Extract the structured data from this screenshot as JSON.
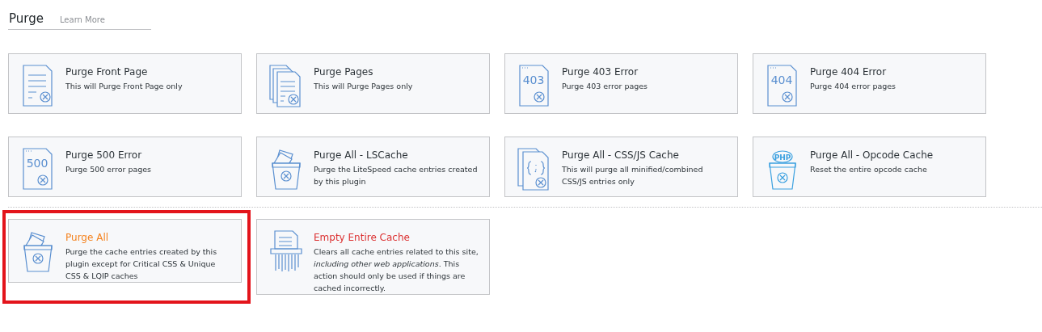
{
  "header": {
    "title": "Purge",
    "link": "Learn More"
  },
  "groups": [
    {
      "cards": [
        {
          "kind": "page",
          "title": "Purge Front Page",
          "description": "This will Purge Front Page only",
          "color": "#2c3338",
          "highlighted": false
        },
        {
          "kind": "pages",
          "title": "Purge Pages",
          "description": "This will Purge Pages only",
          "color": "#2c3338",
          "highlighted": false
        },
        {
          "kind": "error",
          "code": "403",
          "title": "Purge 403 Error",
          "description": "Purge 403 error pages",
          "color": "#2c3338",
          "highlighted": false
        },
        {
          "kind": "error",
          "code": "404",
          "title": "Purge 404 Error",
          "description": "Purge 404 error pages",
          "color": "#2c3338",
          "highlighted": false
        },
        {
          "kind": "error",
          "code": "500",
          "title": "Purge 500 Error",
          "description": "Purge 500 error pages",
          "color": "#2c3338",
          "highlighted": false
        },
        {
          "kind": "bin",
          "title": "Purge All - LSCache",
          "description": "Purge the LiteSpeed cache entries created by this plugin",
          "color": "#2c3338",
          "highlighted": false
        },
        {
          "kind": "code",
          "title": "Purge All - CSS/JS Cache",
          "description": "This will purge all minified/combined CSS/JS entries only",
          "color": "#2c3338",
          "highlighted": false
        },
        {
          "kind": "php",
          "code": "PHP",
          "title": "Purge All - Opcode Cache",
          "description": "Reset the entire opcode cache",
          "color": "#2c3338",
          "highlighted": false
        }
      ]
    },
    {
      "cards": [
        {
          "kind": "bin",
          "title": "Purge All",
          "description": "Purge the cache entries created by this plugin except for Critical CSS & Unique CSS & LQIP caches",
          "color": "#f5831f",
          "highlighted": true
        },
        {
          "kind": "shredder",
          "title": "Empty Entire Cache",
          "description": "Clears all cache entries related to this site, *including other web applications*. This action should only be used if things are cached incorrectly.",
          "color": "#dc3232",
          "highlighted": false
        }
      ]
    }
  ]
}
